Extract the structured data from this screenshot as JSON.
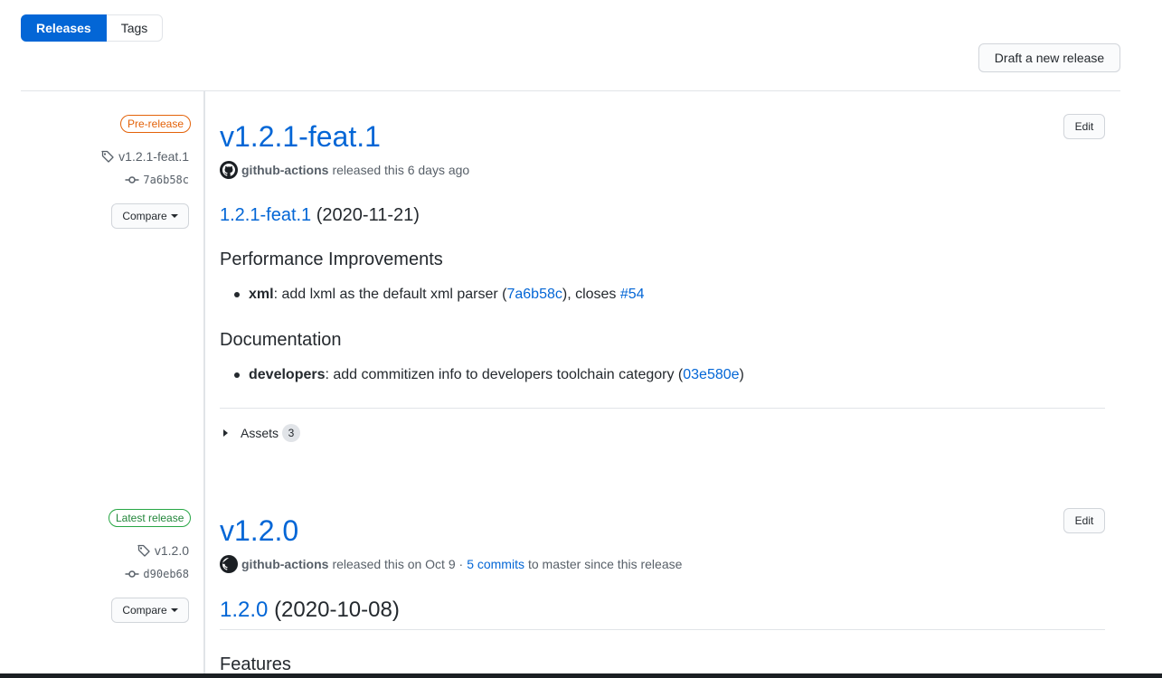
{
  "tabs": [
    {
      "label": "Releases",
      "selected": true
    },
    {
      "label": "Tags",
      "selected": false
    }
  ],
  "draft_button": "Draft a new release",
  "releases": [
    {
      "badge": "Pre-release",
      "tag": "v1.2.1-feat.1",
      "commit": "7a6b58c",
      "compare": "Compare",
      "title": "v1.2.1-feat.1",
      "edit": "Edit",
      "author": "github-actions",
      "released_text": "released this 6 days ago",
      "changelog_link": "1.2.1-feat.1",
      "changelog_date": "(2020-11-21)",
      "sections": [
        {
          "heading": "Performance Improvements",
          "items": [
            {
              "scope": "xml",
              "text": ": add lxml as the default xml parser (",
              "link": "7a6b58c",
              "after": "), closes ",
              "link2": "#54"
            }
          ]
        },
        {
          "heading": "Documentation",
          "items": [
            {
              "scope": "developers",
              "text": ": add commitizen info to developers toolchain category (",
              "link": "03e580e",
              "after": ")"
            }
          ]
        }
      ],
      "assets_label": "Assets",
      "assets_count": "3"
    },
    {
      "badge": "Latest release",
      "tag": "v1.2.0",
      "commit": "d90eb68",
      "compare": "Compare",
      "title": "v1.2.0",
      "edit": "Edit",
      "author": "github-actions",
      "released_text": "released this on Oct 9 ·",
      "commits_link": "5 commits",
      "commits_after": "to master since this release",
      "changelog_link": "1.2.0",
      "changelog_date": "(2020-10-08)",
      "next_heading": "Features"
    }
  ],
  "colors": {
    "accent": "#0366d6",
    "prerelease": "#e36209",
    "latest": "#28a745",
    "muted": "#586069"
  }
}
